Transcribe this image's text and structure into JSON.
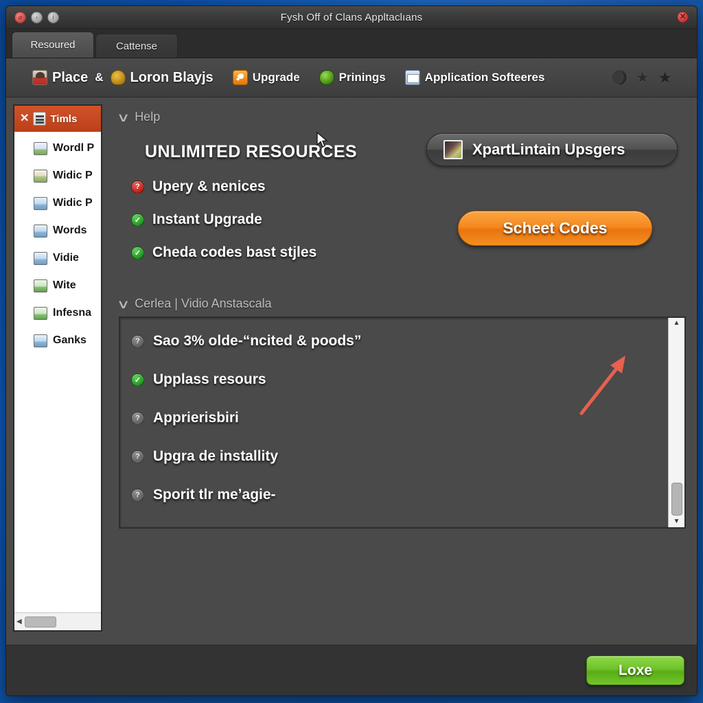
{
  "window": {
    "title": "Fysh Off of Clans Appltaclıans",
    "controls": {
      "button1": "⌀",
      "button2": "‹",
      "button3": "i",
      "close": "✕"
    }
  },
  "tabs": [
    {
      "label": "Resoured",
      "active": true
    },
    {
      "label": "Cattense",
      "active": false
    }
  ],
  "toolbar": {
    "items": [
      {
        "label": "Place",
        "icon": "person-icon"
      },
      {
        "amp": "&"
      },
      {
        "label": "Loron Blayjs",
        "icon": "trophy-icon"
      },
      {
        "label": "Upgrade",
        "icon": "orange-badge-icon"
      },
      {
        "label": "Prinings",
        "icon": "gem-icon"
      },
      {
        "label": "Application Softeeres",
        "icon": "mail-icon"
      }
    ],
    "right_icons": [
      "moon-icon",
      "star-icon",
      "star-filled-icon"
    ]
  },
  "sidebar": {
    "header": {
      "close": "✕",
      "label": "Timls",
      "icon": "document-icon"
    },
    "items": [
      {
        "label": "Wordl P",
        "icon": "image-icon"
      },
      {
        "label": "Widic P",
        "icon": "image-icon"
      },
      {
        "label": "Widic P",
        "icon": "image-icon"
      },
      {
        "label": "Words",
        "icon": "image-icon"
      },
      {
        "label": "Vidie",
        "icon": "image-icon"
      },
      {
        "label": "Wite",
        "icon": "image-icon"
      },
      {
        "label": "Infesna",
        "icon": "image-icon"
      },
      {
        "label": "Ganks",
        "icon": "image-icon"
      }
    ],
    "hscroll": {
      "left_arrow": "◀"
    }
  },
  "main": {
    "help_section": {
      "chevron": "∨",
      "title": "Help"
    },
    "hero_title": "UNLIMITED RESOURCES",
    "features": [
      {
        "label": "Upery & nenices",
        "status": "question",
        "glyph": "?"
      },
      {
        "label": "Instant Upgrade",
        "status": "check",
        "glyph": "✓"
      },
      {
        "label": "Cheda codes bast stjles",
        "status": "check",
        "glyph": "✓"
      }
    ],
    "primary_button": {
      "label": "XpartLintain Upsgers",
      "icon": "thumbnail-icon"
    },
    "cta_button": {
      "label": "Scheet Codes",
      "color": "#f58a20"
    },
    "list_section": {
      "chevron": "∨",
      "title": "Cerlea | Vidio Anstascala"
    },
    "list_items": [
      {
        "label": "Sao 3% olde-“ncited & poods”",
        "status": "question",
        "glyph": "?"
      },
      {
        "label": "Upplass resours",
        "status": "check",
        "glyph": "✓"
      },
      {
        "label": "Apprierisbiri",
        "status": "question",
        "glyph": "?"
      },
      {
        "label": "Upgra de installity",
        "status": "question",
        "glyph": "?"
      },
      {
        "label": "Sporit tlr meʼagie-",
        "status": "question",
        "glyph": "?"
      }
    ],
    "vscroll": {
      "up": "▲",
      "down": "▼"
    }
  },
  "footer": {
    "close_button": {
      "label": "Loxe",
      "color": "#6ec229"
    }
  },
  "annotation": {
    "arrow_color": "#e8604f"
  }
}
